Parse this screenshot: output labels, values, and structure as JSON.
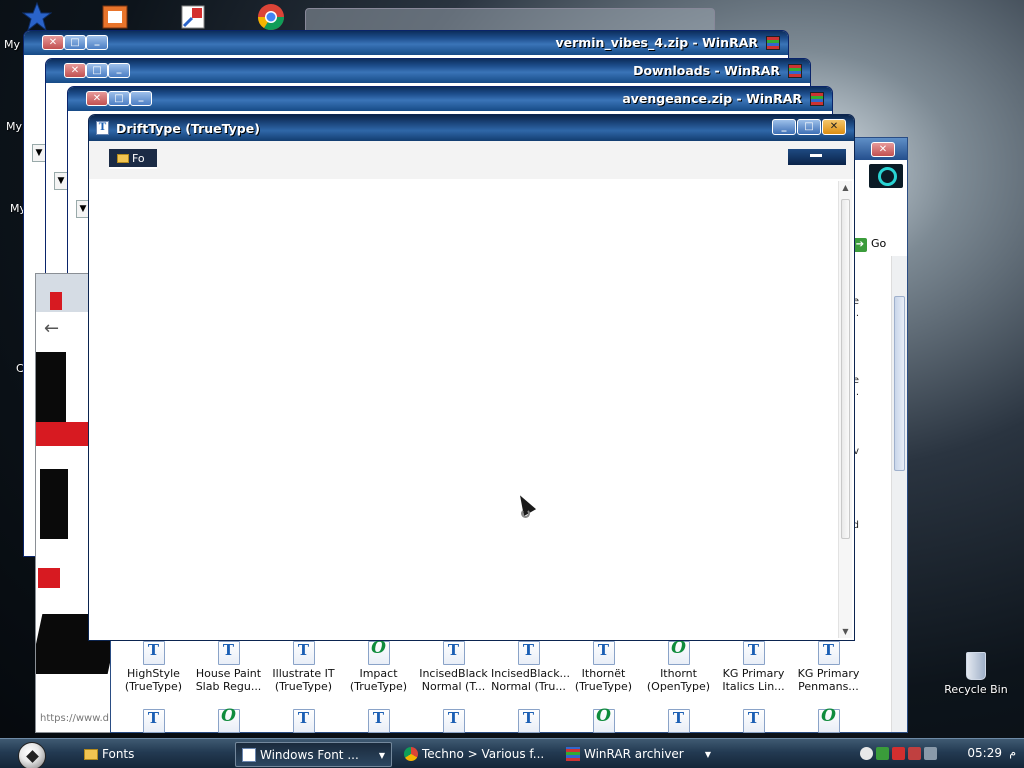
{
  "desktop": {
    "labels_left": [
      "My",
      "My",
      "My",
      "C"
    ],
    "recycle_bin": "Recycle Bin"
  },
  "windows": [
    {
      "title": "vermin_vibes_4.zip - WinRAR"
    },
    {
      "title": "Downloads - WinRAR"
    },
    {
      "title": "avengeance.zip - WinRAR"
    }
  ],
  "fonts_window": {
    "go_label": "Go",
    "items_row1": [
      {
        "name": "HighStyle",
        "type": "(TrueType)",
        "kind": "ttf"
      },
      {
        "name": "House Paint",
        "type": "Slab Regu...",
        "kind": "ttf"
      },
      {
        "name": "Illustrate IT",
        "type": "(TrueType)",
        "kind": "ttf"
      },
      {
        "name": "Impact",
        "type": "(TrueType)",
        "kind": "otf"
      },
      {
        "name": "IncisedBlack",
        "type": "Normal (T...",
        "kind": "ttf"
      },
      {
        "name": "IncisedBlack...",
        "type": "Normal (Tru...",
        "kind": "ttf"
      },
      {
        "name": "Ithornët",
        "type": "(TrueType)",
        "kind": "ttf"
      },
      {
        "name": "Ithornt",
        "type": "(OpenType)",
        "kind": "otf"
      },
      {
        "name": "KG Primary",
        "type": "Italics Lin...",
        "kind": "ttf"
      },
      {
        "name": "KG Primary",
        "type": "Penmans...",
        "kind": "ttf"
      }
    ],
    "row2_kinds": [
      "ttf",
      "otf",
      "ttf",
      "ttf",
      "ttf",
      "ttf",
      "otf",
      "ttf",
      "ttf",
      "otf"
    ],
    "right_fragments": [
      "e",
      ".",
      "e",
      ".",
      "v",
      "d"
    ]
  },
  "browser_fragment": {
    "url": "https://www.d"
  },
  "main_window": {
    "title": "DriftType (TrueType)",
    "icon_letter": "T",
    "toolbar_button": "Fo"
  },
  "taskbar": {
    "tasks": [
      {
        "label": "Fonts",
        "active": false
      },
      {
        "label": "Windows Font ...",
        "active": true
      },
      {
        "label": "Techno > Various f...",
        "active": false
      },
      {
        "label": "WinRAR archiver",
        "active": false
      }
    ],
    "clock": "05:29",
    "clock_suffix": "م"
  },
  "colors": {
    "titlebar": "#1e4a82",
    "close_button": "#c25151",
    "accent_close_main": "#dc8e12",
    "truetype_icon": "#1b5fb4",
    "opentype_icon": "#0f8c3c"
  }
}
